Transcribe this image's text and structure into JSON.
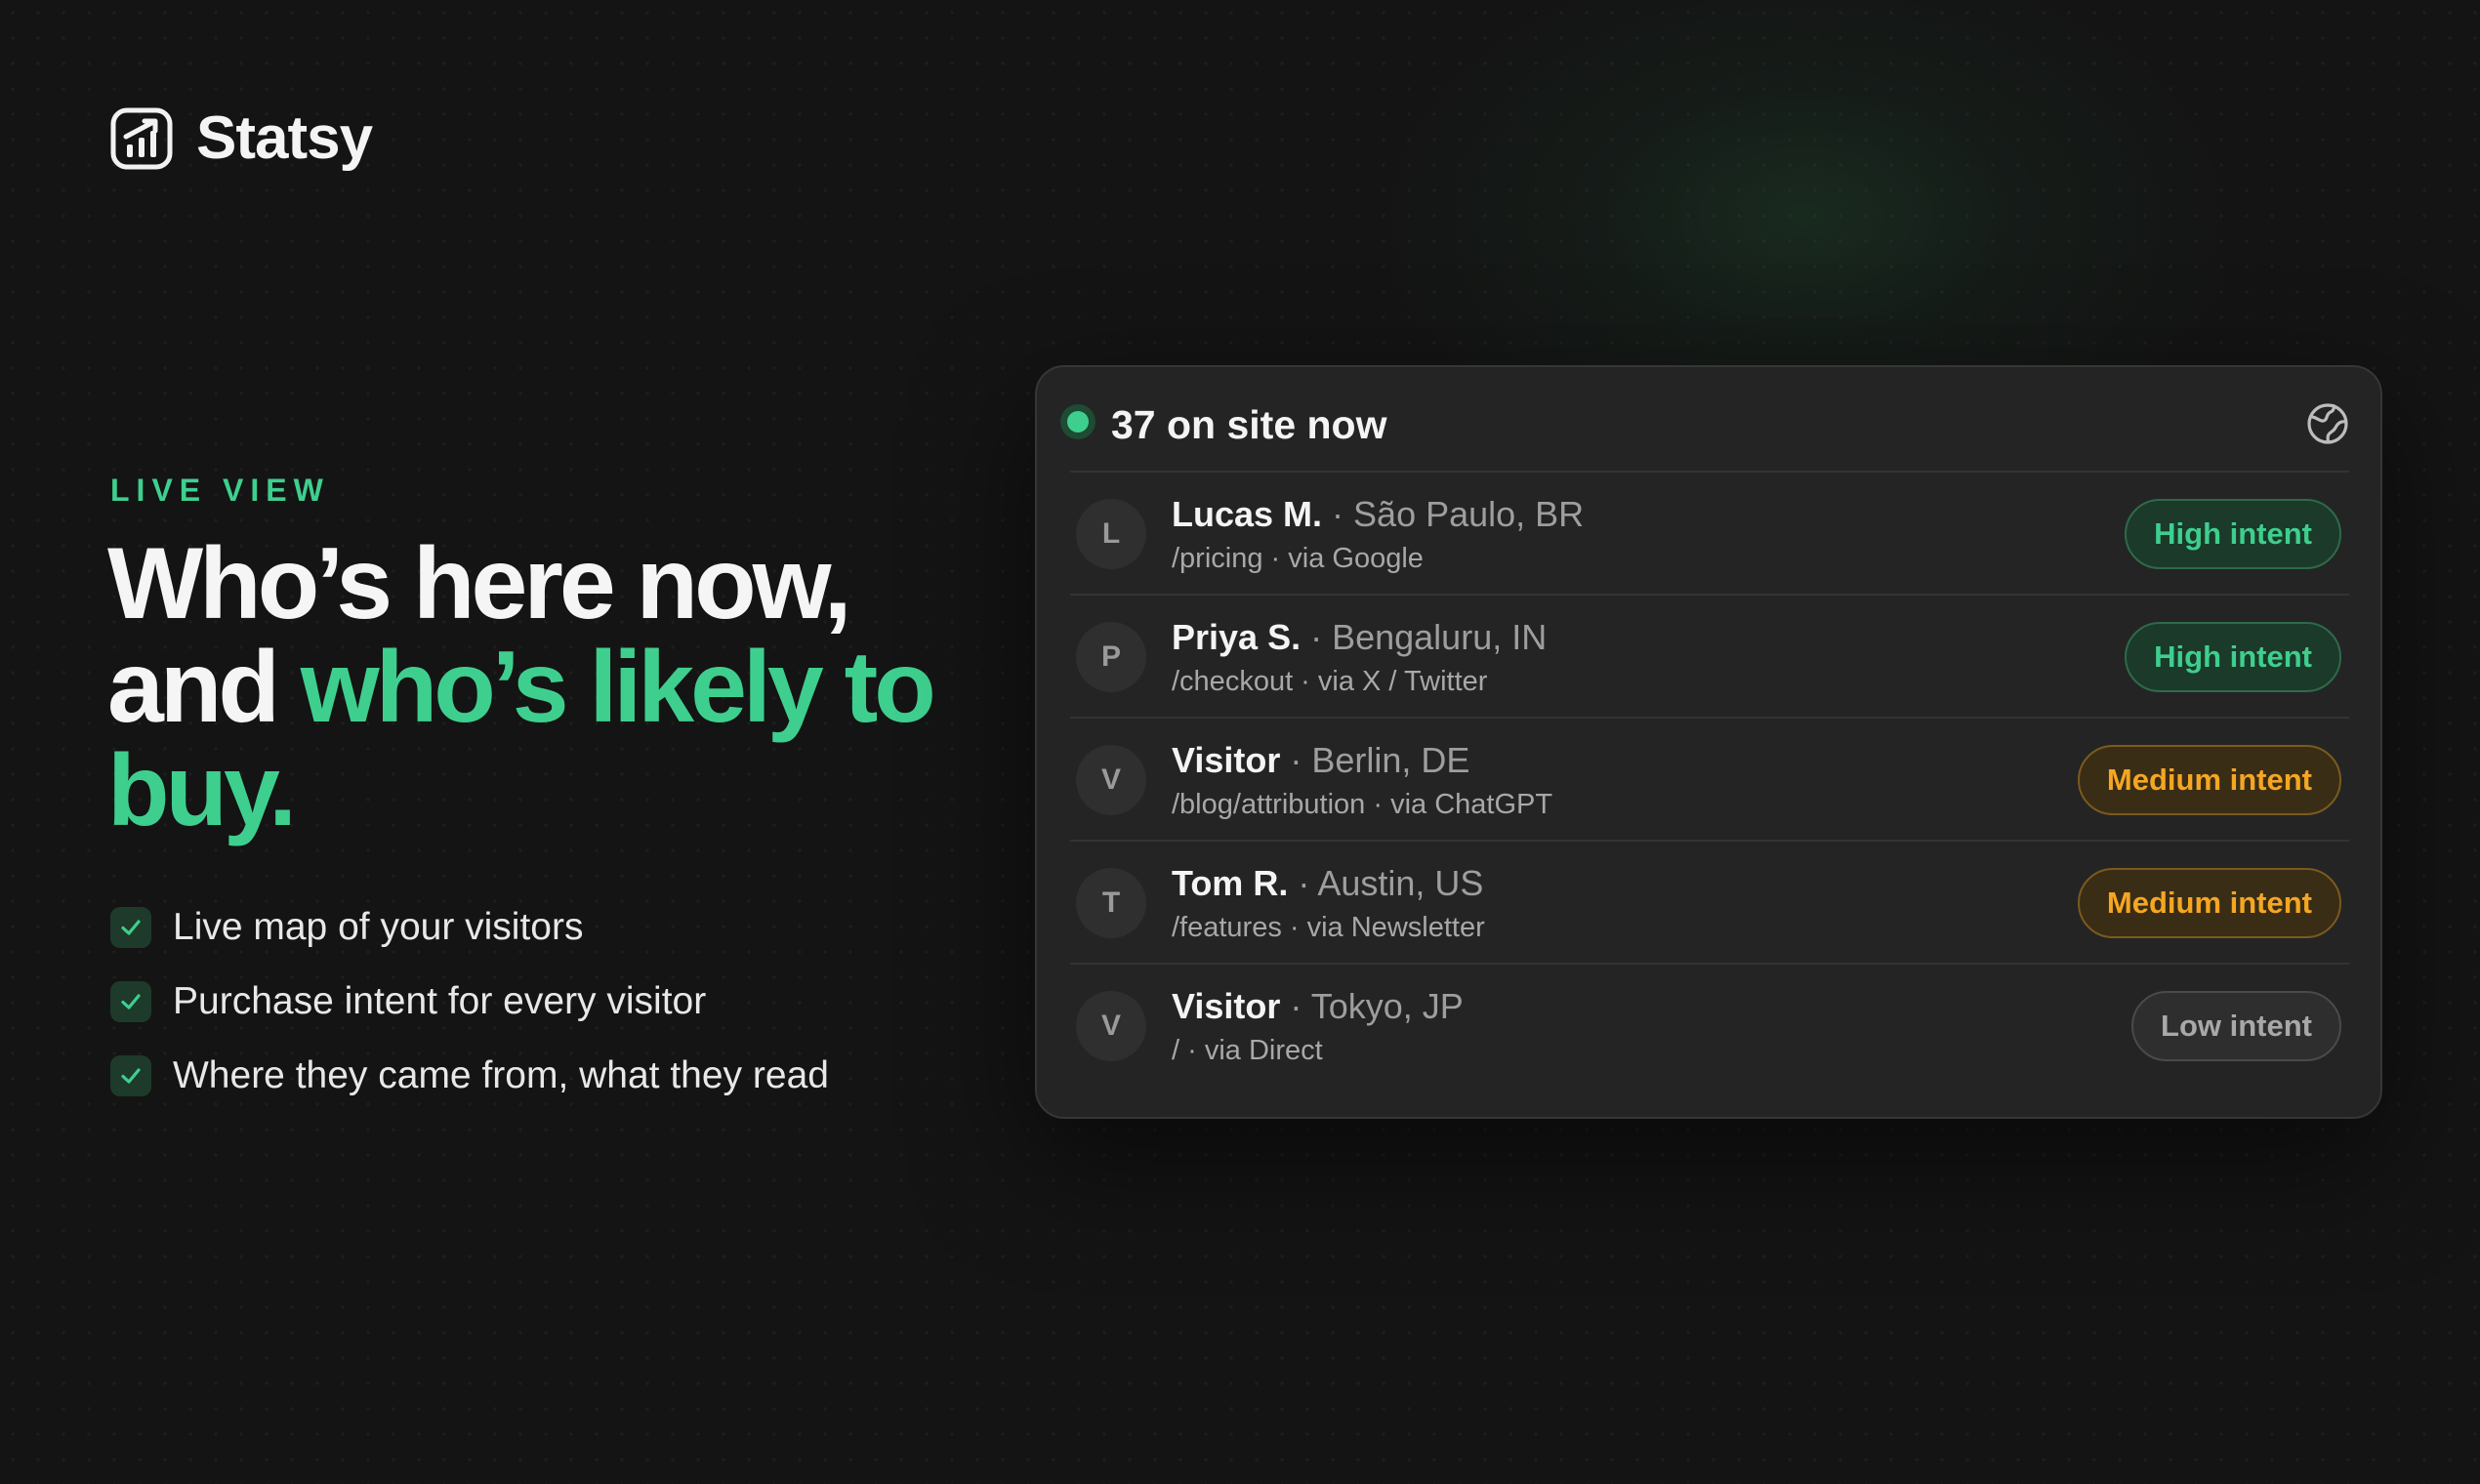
{
  "brand": {
    "name": "Statsy"
  },
  "hero": {
    "eyebrow": "LIVE VIEW",
    "headline_part1": "Who’s here now, and ",
    "headline_accent": "who’s likely to buy.",
    "features": [
      "Live map of your visitors",
      "Purchase intent for every visitor",
      "Where they came from, what they read"
    ]
  },
  "panel": {
    "live_count_label": "37 on site now",
    "visitors": [
      {
        "initial": "L",
        "name": "Lucas M.",
        "location": " · São Paulo, BR",
        "path": "/pricing · via Google",
        "intent": "High intent",
        "level": "high"
      },
      {
        "initial": "P",
        "name": "Priya S.",
        "location": " · Bengaluru, IN",
        "path": "/checkout · via X / Twitter",
        "intent": "High intent",
        "level": "high"
      },
      {
        "initial": "V",
        "name": "Visitor",
        "location": " · Berlin, DE",
        "path": "/blog/attribution · via ChatGPT",
        "intent": "Medium intent",
        "level": "medium"
      },
      {
        "initial": "T",
        "name": "Tom R.",
        "location": " · Austin, US",
        "path": "/features · via Newsletter",
        "intent": "Medium intent",
        "level": "medium"
      },
      {
        "initial": "V",
        "name": "Visitor",
        "location": " · Tokyo, JP",
        "path": "/ · via Direct",
        "intent": "Low intent",
        "level": "low"
      }
    ]
  },
  "colors": {
    "accent": "#3ecf8e",
    "medium": "#f5a623",
    "low": "#a8a8a8",
    "background": "#141414",
    "panel": "#242424"
  },
  "icons": {
    "logo": "chart-bars-icon",
    "live": "live-dot-icon",
    "globe": "globe-icon",
    "check": "check-icon"
  }
}
